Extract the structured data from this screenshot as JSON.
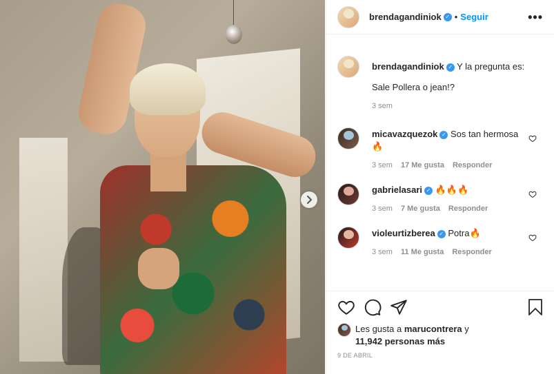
{
  "post": {
    "author": "brendagandiniok",
    "follow_label": "Seguir",
    "more_label": "•••"
  },
  "caption": {
    "username": "brendagandiniok",
    "text_line1": "Y la pregunta es:",
    "text_line2": "Sale Pollera o jean!?",
    "time": "3 sem"
  },
  "comments": [
    {
      "username": "micavazquezok",
      "verified": true,
      "text": "Sos tan hermosa 🔥",
      "time": "3 sem",
      "likes": "17 Me gusta",
      "reply": "Responder"
    },
    {
      "username": "gabrielasari",
      "verified": true,
      "text": "🔥🔥🔥",
      "time": "3 sem",
      "likes": "7 Me gusta",
      "reply": "Responder"
    },
    {
      "username": "violeurtizberea",
      "verified": true,
      "text": "Potra🔥",
      "time": "3 sem",
      "likes": "11 Me gusta",
      "reply": "Responder"
    }
  ],
  "likes": {
    "prefix": "Les gusta a",
    "user": "marucontrera",
    "conj": "y",
    "count": "11,942 personas más"
  },
  "date": "9 DE ABRIL",
  "colors": {
    "accent": "#0095f6",
    "verified": "#3897f0",
    "muted": "#8e8e8e"
  },
  "icons": [
    "heart-icon",
    "comment-icon",
    "share-icon",
    "bookmark-icon",
    "chevron-right-icon",
    "verified-icon",
    "more-options-icon"
  ]
}
